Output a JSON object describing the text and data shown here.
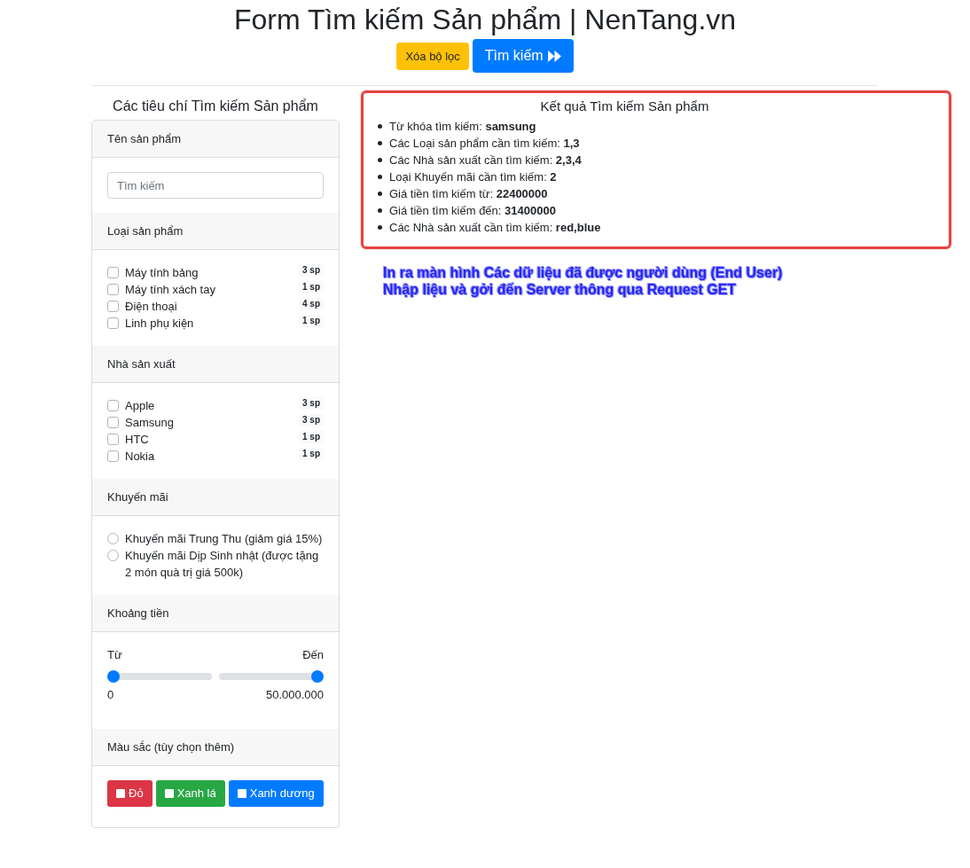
{
  "page": {
    "title": "Form Tìm kiếm Sản phẩm | NenTang.vn"
  },
  "actions": [
    {
      "kind": "clear",
      "label": "Xóa bộ lọc"
    },
    {
      "kind": "search",
      "label": "Tìm kiếm"
    }
  ],
  "filters": {
    "heading": "Các tiêu chí Tìm kiếm Sản phẩm",
    "sections": [
      {
        "kind": "text",
        "title": "Tên sản phẩm",
        "placeholder": "Tìm kiếm"
      },
      {
        "kind": "checkboxes",
        "title": "Loại sản phẩm",
        "items": [
          {
            "label": "Máy tính bảng",
            "count": "3 sp",
            "checked": false
          },
          {
            "label": "Máy tính xách tay",
            "count": "1 sp",
            "checked": false
          },
          {
            "label": "Điện thoại",
            "count": "4 sp",
            "checked": false
          },
          {
            "label": "Linh phụ kiện",
            "count": "1 sp",
            "checked": false
          }
        ]
      },
      {
        "kind": "checkboxes",
        "title": "Nhà sản xuất",
        "items": [
          {
            "label": "Apple",
            "count": "3 sp",
            "checked": false
          },
          {
            "label": "Samsung",
            "count": "3 sp",
            "checked": false
          },
          {
            "label": "HTC",
            "count": "1 sp",
            "checked": false
          },
          {
            "label": "Nokia",
            "count": "1 sp",
            "checked": false
          }
        ]
      },
      {
        "kind": "radios",
        "title": "Khuyến mãi",
        "items": [
          {
            "label": "Khuyến mãi Trung Thu (giảm giá 15%)",
            "selected": false
          },
          {
            "label": "Khuyến mãi Dịp Sinh nhật (được tặng 2 món quà trị giá 500k)",
            "selected": false
          }
        ]
      },
      {
        "kind": "range",
        "title": "Khoảng tiền",
        "from_label": "Từ",
        "to_label": "Đến",
        "sliders": [
          {
            "level": 0
          },
          {
            "level": 1
          }
        ],
        "min_reading": "0",
        "max_reading": "50.000.000"
      },
      {
        "kind": "colors",
        "title": "Màu sắc (tùy chọn thêm)",
        "items": [
          {
            "label": "Đỏ",
            "color": "#dc3545",
            "checked": false
          },
          {
            "label": "Xanh lá",
            "color": "#28a745",
            "checked": false
          },
          {
            "label": "Xanh dương",
            "color": "#007bff",
            "checked": false
          }
        ]
      }
    ]
  },
  "results": {
    "title": "Kết quả Tìm kiếm Sản phẩm",
    "items": [
      "Từ khóa tìm kiếm: **samsung**",
      "Các Loại sản phẩm cần tìm kiếm: **1,3**",
      "Các Nhà sản xuất cần tìm kiếm: **2,3,4**",
      "Loại Khuyến mãi cần tìm kiếm: **2**",
      "Giá tiền tìm kiếm từ: **22400000**",
      "Giá tiền tìm kiếm đến: **31400000**",
      "Các Nhà sản xuất cần tìm kiếm: **red,blue**"
    ]
  },
  "annotation": {
    "lines": [
      "In ra màn hình Các dữ liệu đã được người dùng (End User)",
      "Nhập liệu và gởi đến Server thông qua Request GET"
    ]
  }
}
